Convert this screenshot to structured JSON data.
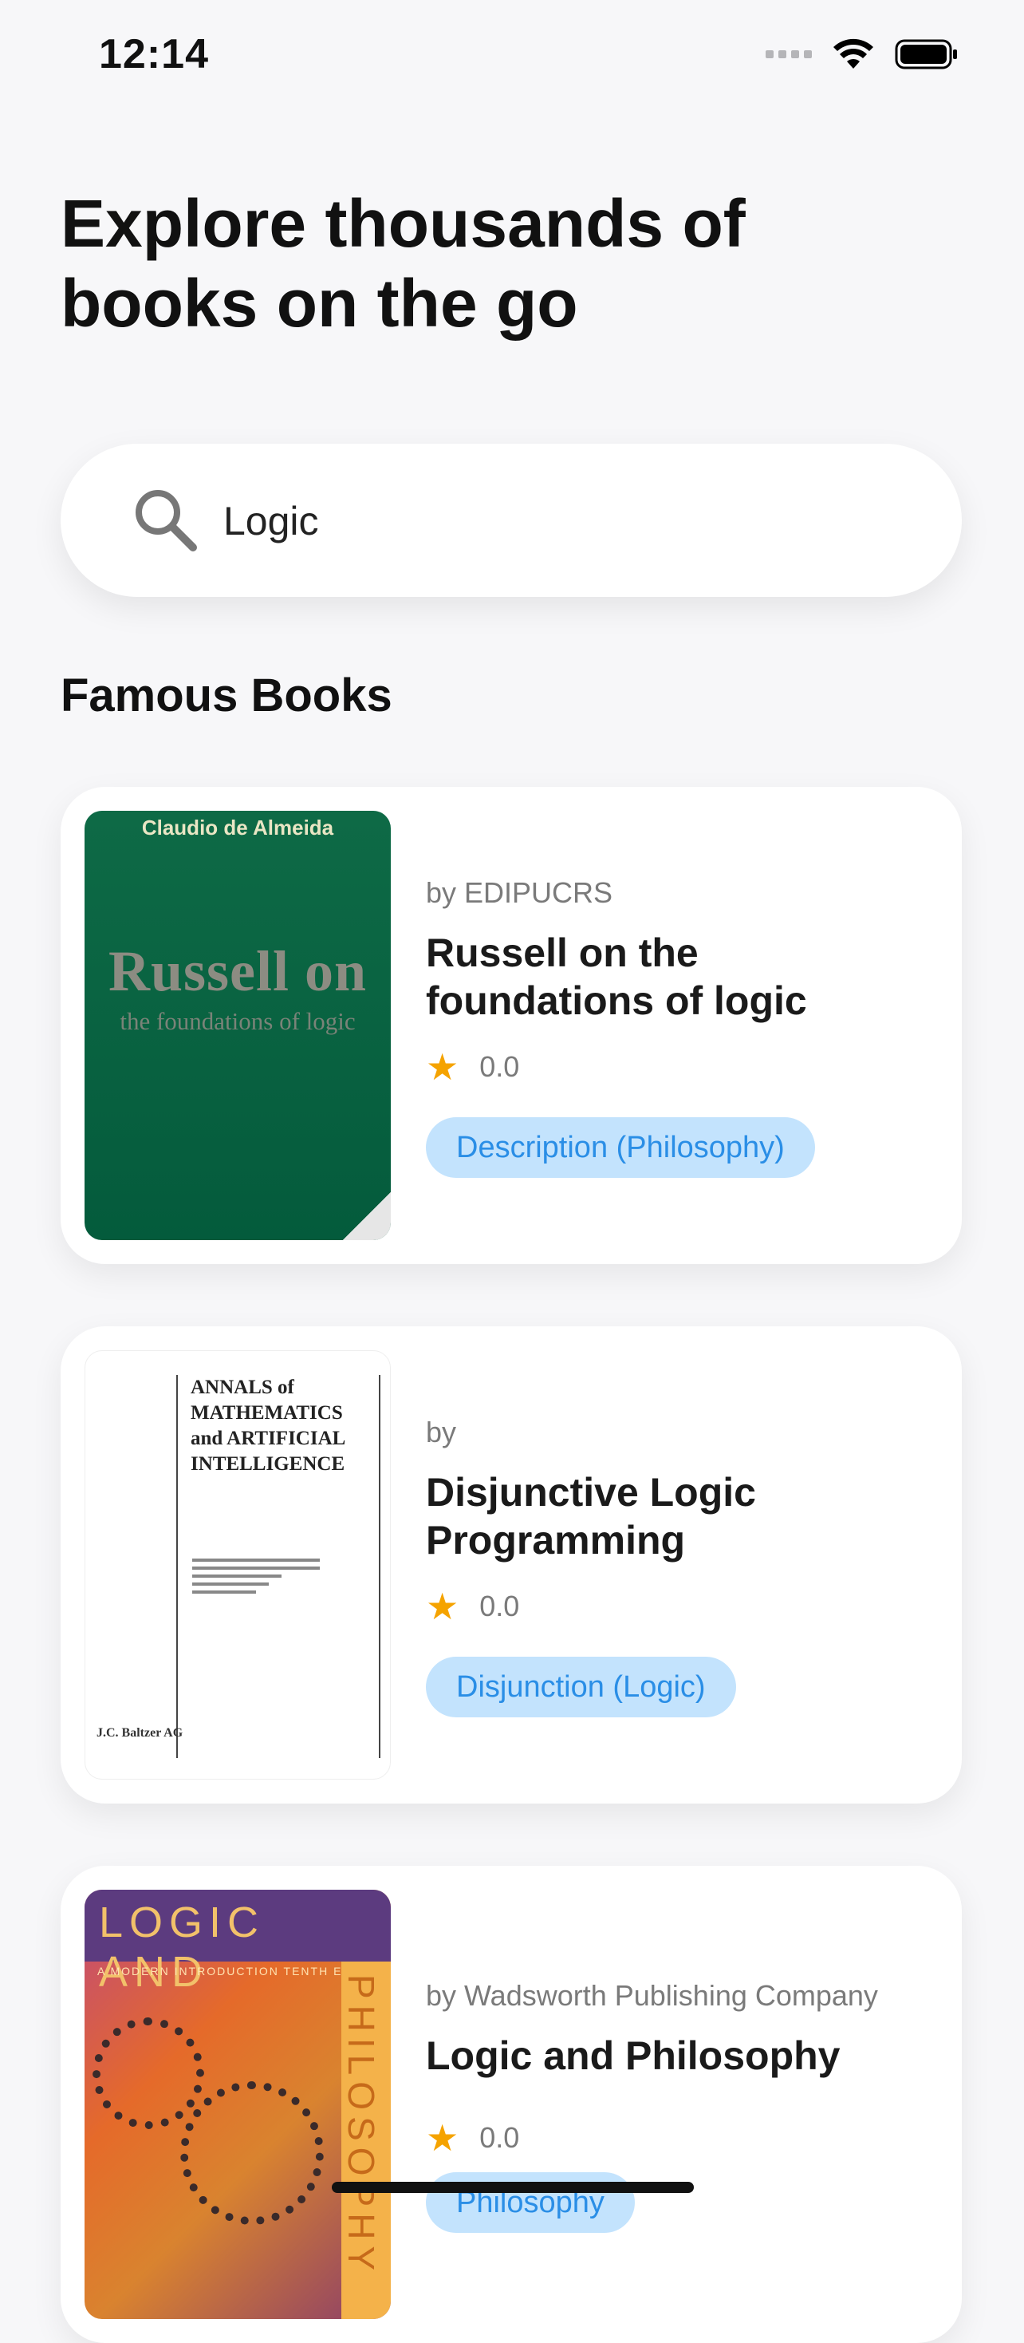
{
  "status_bar": {
    "time": "12:14"
  },
  "headline": "Explore thousands of books on the go",
  "search": {
    "value": "Logic",
    "placeholder": ""
  },
  "section_title": "Famous Books",
  "books": [
    {
      "author": "by EDIPUCRS",
      "title": "Russell on the foundations of logic",
      "rating": "0.0",
      "tag": "Description (Philosophy)",
      "cover": {
        "author": "Claudio de Almeida",
        "title": "Russell on",
        "subtitle": "the foundations of logic"
      }
    },
    {
      "author": "by",
      "title": "Disjunctive Logic Programming",
      "rating": "0.0",
      "tag": "Disjunction (Logic)",
      "cover": {
        "title": "ANNALS of MATHEMATICS and ARTIFICIAL INTELLIGENCE",
        "publisher": "J.C. Baltzer AG"
      }
    },
    {
      "author": "by Wadsworth Publishing Company",
      "title": "Logic and Philosophy",
      "rating": "0.0",
      "tag": "Philosophy",
      "cover": {
        "title": "LOGIC AND",
        "vertical": "PHILOSOPHY",
        "subtitle": "A MODERN INTRODUCTION  TENTH EDITION"
      }
    }
  ],
  "colors": {
    "accent": "#2a8ee6",
    "tag_bg": "#c3e3fd",
    "star": "#f5a300"
  }
}
